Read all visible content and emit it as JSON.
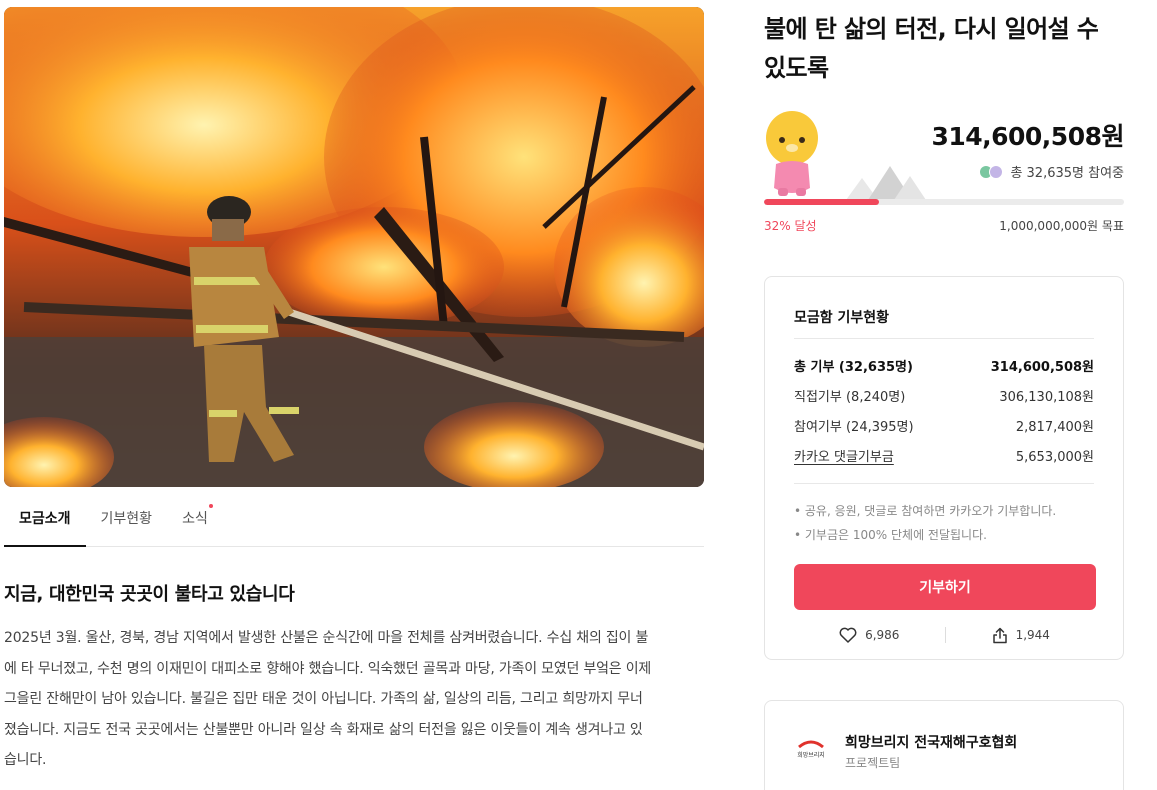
{
  "hero": {
    "icon": "firefighter-fire-photo"
  },
  "tabs": [
    {
      "label": "모금소개",
      "active": true
    },
    {
      "label": "기부현황",
      "active": false
    },
    {
      "label": "소식",
      "active": false,
      "has_dot": true
    }
  ],
  "story": {
    "title": "지금, 대한민국 곳곳이 불타고 있습니다",
    "body_lines": [
      "2025년 3월. 울산, 경북, 경남 지역에서 발생한 산불은 순식간에 마을 전체를 삼켜버렸습니다. 수십 채의 집이 불",
      "에 타 무너졌고, 수천 명의 이재민이 대피소로 향해야 했습니다. 익숙했던 골목과 마당, 가족이 모였던 부엌은 이제",
      "그을린 잔해만이 남아 있습니다. 불길은 집만 태운 것이 아닙니다. 가족의 삶, 일상의 리듬, 그리고 희망까지 무너",
      "졌습니다. 지금도 전국 곳곳에서는 산불뿐만 아니라 일상 속 화재로 삶의 터전을 잃은 이웃들이 계속 생겨나고 있",
      "습니다."
    ]
  },
  "campaign": {
    "title": "불에 탄 삶의 터전, 다시 일어설 수 있도록",
    "amount": "314,600,508원",
    "participants": "총 32,635명 참여중",
    "progress_label": "32% 달성",
    "progress_percent": 32,
    "goal_label": "1,000,000,000원 목표",
    "accent_color": "#f0475b"
  },
  "status_card": {
    "title": "모금함 기부현황",
    "rows": [
      {
        "label": "총 기부 (32,635명)",
        "value": "314,600,508원"
      },
      {
        "label": "직접기부 (8,240명)",
        "value": "306,130,108원"
      },
      {
        "label": "참여기부 (24,395명)",
        "value": "2,817,400원"
      },
      {
        "label": "카카오 댓글기부금",
        "value": "5,653,000원"
      }
    ],
    "notes": [
      "• 공유, 응원, 댓글로 참여하면 카카오가 기부합니다.",
      "• 기부금은 100% 단체에 전달됩니다."
    ],
    "donate_label": "기부하기",
    "likes": "6,986",
    "shares": "1,944"
  },
  "org": {
    "name": "희망브리지 전국재해구호협회",
    "subtitle": "프로젝트팀",
    "logo_text": "희망브리지"
  }
}
